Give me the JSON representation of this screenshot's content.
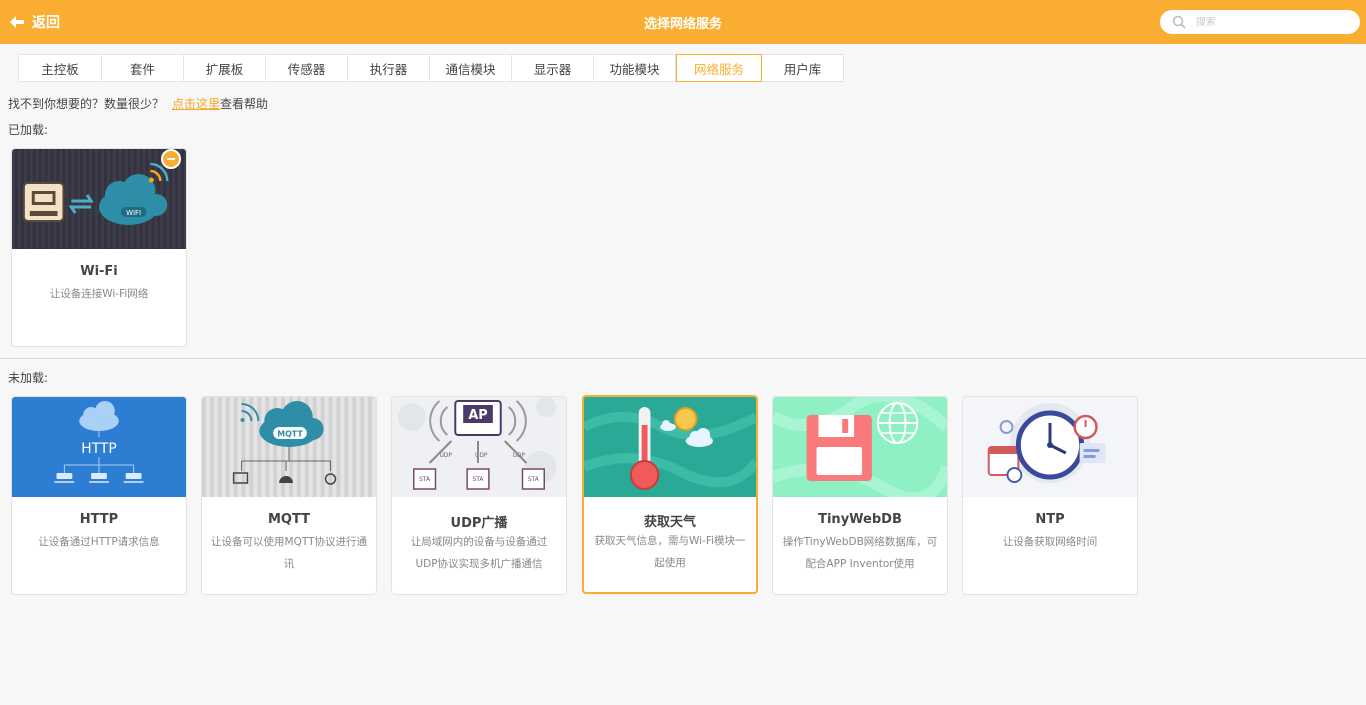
{
  "header": {
    "back_label": "返回",
    "title": "选择网络服务",
    "search_placeholder": "搜索",
    "accent_color": "#f9ae32"
  },
  "tabs": [
    {
      "label": "主控板",
      "active": false
    },
    {
      "label": "套件",
      "active": false
    },
    {
      "label": "扩展板",
      "active": false
    },
    {
      "label": "传感器",
      "active": false
    },
    {
      "label": "执行器",
      "active": false
    },
    {
      "label": "通信模块",
      "active": false
    },
    {
      "label": "显示器",
      "active": false
    },
    {
      "label": "功能模块",
      "active": false
    },
    {
      "label": "网络服务",
      "active": true
    },
    {
      "label": "用户库",
      "active": false
    }
  ],
  "help": {
    "prefix": "找不到你想要的？数量很少？",
    "link": "点击这里",
    "suffix": "查看帮助"
  },
  "loaded": {
    "label": "已加载:",
    "cards": [
      {
        "name": "Wi-Fi",
        "desc": "让设备连接Wi-Fi网络",
        "icon": "wifi-cloud-image"
      }
    ]
  },
  "unloaded": {
    "label": "未加载:",
    "cards": [
      {
        "name": "HTTP",
        "desc": "让设备通过HTTP请求信息",
        "icon": "http-cloud-image"
      },
      {
        "name": "MQTT",
        "desc": "让设备可以使用MQTT协议进行通讯",
        "icon": "mqtt-cloud-image"
      },
      {
        "name": "UDP广播",
        "desc": "让局域网内的设备与设备通过UDP协议实现多机广播通信",
        "icon": "udp-ap-image"
      },
      {
        "name": "获取天气",
        "desc": "获取天气信息，需与Wi-Fi模块一起使用",
        "icon": "weather-thermometer-image"
      },
      {
        "name": "TinyWebDB",
        "desc": "操作TinyWebDB网络数据库，可配合APP Inventor使用",
        "icon": "floppy-disk-image"
      },
      {
        "name": "NTP",
        "desc": "让设备获取网络时间",
        "icon": "clock-image"
      }
    ]
  },
  "art_labels": {
    "wifi": "WIFI",
    "http": "HTTP",
    "mqtt": "MQTT",
    "ap": "AP",
    "sta": "STA",
    "udp": "UDP"
  }
}
